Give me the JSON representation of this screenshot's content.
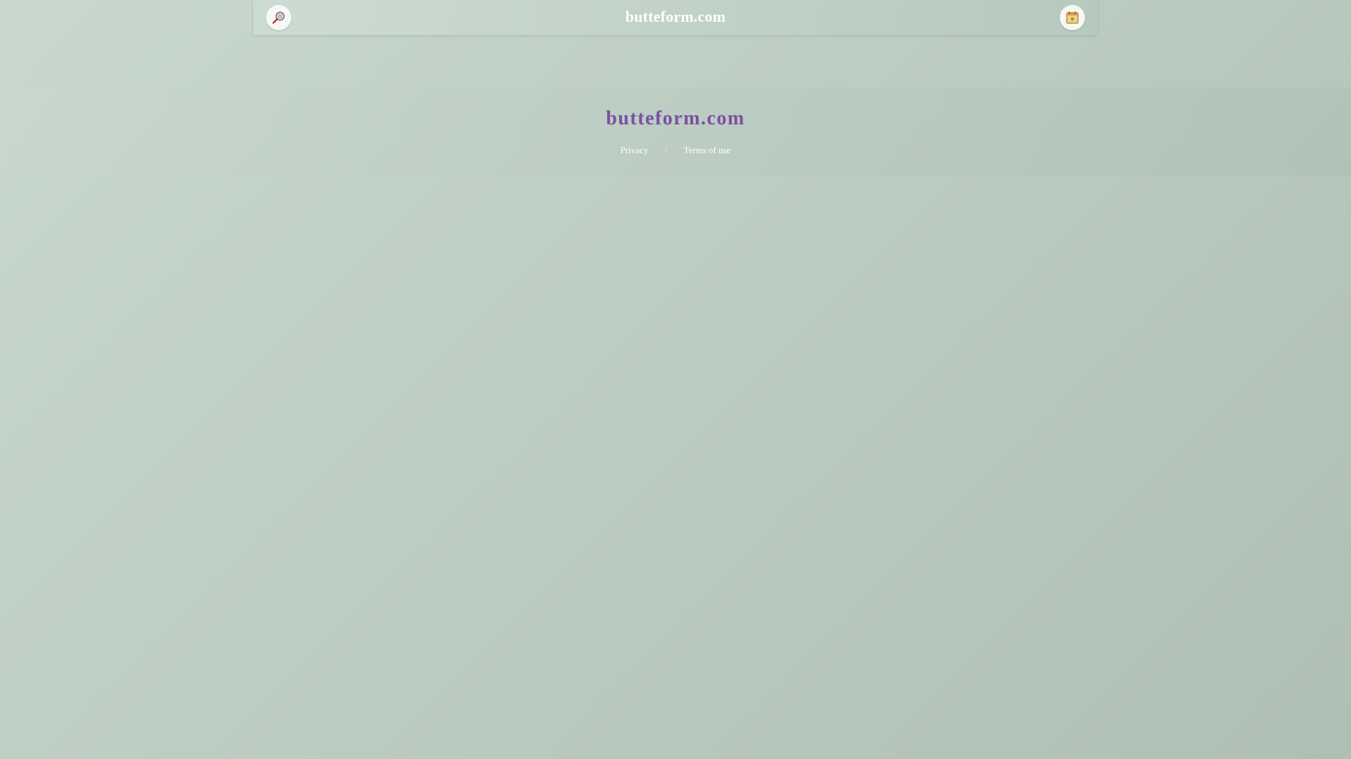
{
  "header": {
    "title": "butteform.com",
    "left_icon": "search-magnifier-icon",
    "right_icon": "calendar-icon"
  },
  "main": {
    "site_name": "butteform.com",
    "links": {
      "privacy": "Privacy",
      "separator": "|",
      "terms": "Terms of use"
    }
  },
  "colors": {
    "site_name": "#7b4fa3",
    "background": "#bccdc2",
    "topbar_text": "#ffffff"
  }
}
